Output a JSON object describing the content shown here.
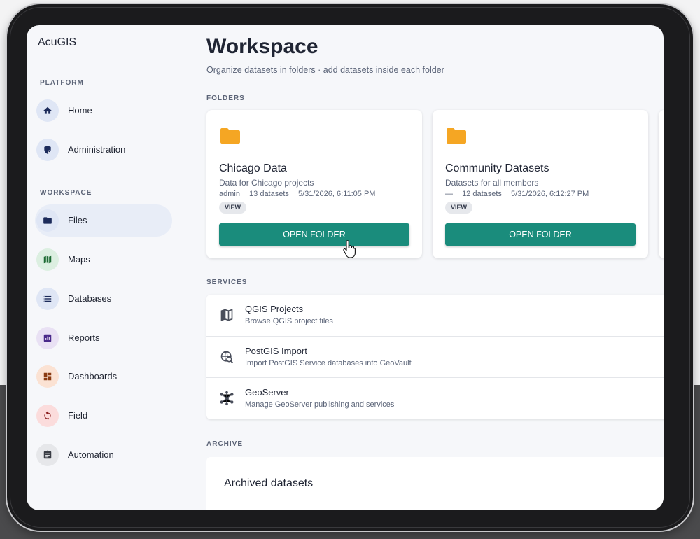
{
  "app": {
    "title": "AcuGIS"
  },
  "sidebar": {
    "platform_label": "PLATFORM",
    "workspace_label": "WORKSPACE",
    "platform_items": [
      {
        "label": "Home",
        "icon": "home-icon"
      },
      {
        "label": "Administration",
        "icon": "admin-shield-icon"
      }
    ],
    "workspace_items": [
      {
        "label": "Files",
        "icon": "folder-icon",
        "active": true
      },
      {
        "label": "Maps",
        "icon": "map-icon"
      },
      {
        "label": "Databases",
        "icon": "database-icon"
      },
      {
        "label": "Reports",
        "icon": "bar-chart-icon"
      },
      {
        "label": "Dashboards",
        "icon": "dashboard-icon"
      },
      {
        "label": "Field",
        "icon": "sync-icon"
      },
      {
        "label": "Automation",
        "icon": "clipboard-icon"
      }
    ]
  },
  "main": {
    "title": "Workspace",
    "subtitle": "Organize datasets in folders · add datasets inside each folder",
    "folders_label": "FOLDERS",
    "folders": [
      {
        "name": "Chicago Data",
        "description": "Data for Chicago projects",
        "owner": "admin",
        "count": "13 datasets",
        "date": "5/31/2026, 6:11:05 PM",
        "badge": "VIEW",
        "button": "OPEN FOLDER"
      },
      {
        "name": "Community Datasets",
        "description": "Datasets for all members",
        "owner": "—",
        "count": "12 datasets",
        "date": "5/31/2026, 6:12:27 PM",
        "badge": "VIEW",
        "button": "OPEN FOLDER"
      }
    ],
    "services_label": "SERVICES",
    "services": [
      {
        "title": "QGIS Projects",
        "description": "Browse QGIS project files",
        "icon": "map-outline-icon"
      },
      {
        "title": "PostGIS Import",
        "description": "Import PostGIS Service databases into GeoVault",
        "icon": "globe-search-icon"
      },
      {
        "title": "GeoServer",
        "description": "Manage GeoServer publishing and services",
        "icon": "network-hub-icon"
      }
    ],
    "archive_label": "ARCHIVE",
    "archive": {
      "title": "Archived datasets"
    }
  },
  "colors": {
    "accent": "#1a8c7c",
    "folder": "#f5a623",
    "active_nav": "#e8edf7"
  }
}
